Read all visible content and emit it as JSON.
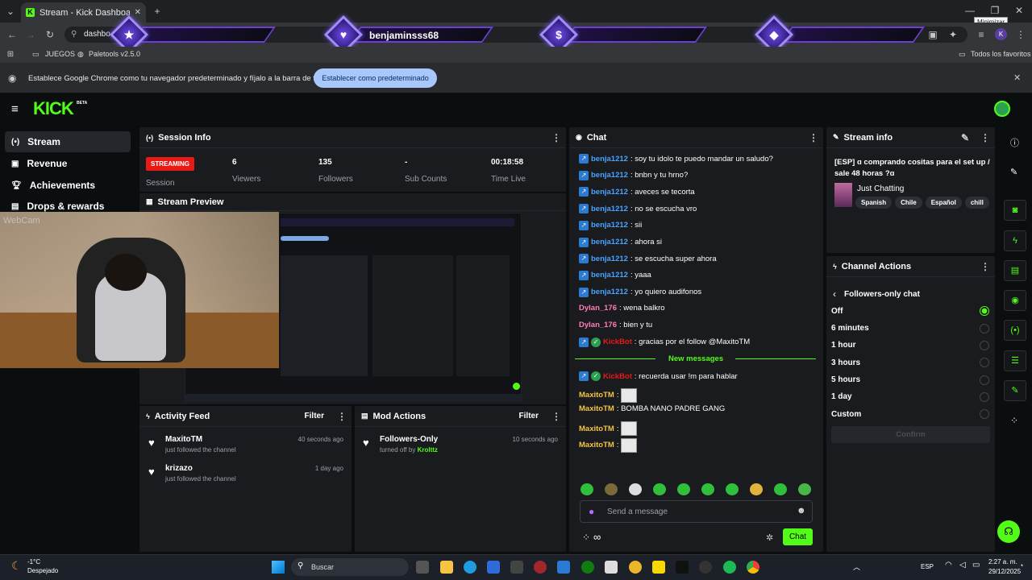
{
  "browser": {
    "tab_title": "Stream - Kick Dashboard",
    "address": "dashbo",
    "tooltip": "Minimizar",
    "bookmarks": [
      "JUEGOS",
      "Paletools v2.5.0"
    ],
    "all_bookmarks": "Todos los favoritos",
    "infobar_text": "Establece Google Chrome como tu navegador predeterminado y fíjalo a la barra de tareas",
    "infobar_button": "Establecer como predeterminado",
    "profile_initial": "K"
  },
  "overlay": {
    "username": "benjaminsss68",
    "icons": [
      "star-icon",
      "heart-icon",
      "dollar-icon",
      "diamond-icon"
    ]
  },
  "kick": {
    "logo": "KICK",
    "logo_badge": "BETA"
  },
  "sidebar": {
    "items": [
      {
        "label": "Stream",
        "icon": "broadcast-icon"
      },
      {
        "label": "Revenue",
        "icon": "revenue-icon"
      },
      {
        "label": "Achievements",
        "icon": "trophy-icon"
      },
      {
        "label": "Drops & rewards",
        "icon": "gift-icon"
      }
    ]
  },
  "session": {
    "title": "Session Info",
    "status": "STREAMING",
    "status_label": "Session",
    "stats": [
      {
        "value": "6",
        "label": "Viewers"
      },
      {
        "value": "135",
        "label": "Followers"
      },
      {
        "value": "-",
        "label": "Sub Counts"
      },
      {
        "value": "00:18:58",
        "label": "Time Live"
      }
    ]
  },
  "preview": {
    "title": "Stream Preview",
    "webcam_label": "WebCam"
  },
  "activity": {
    "title": "Activity Feed",
    "filter": "Filter",
    "items": [
      {
        "name": "MaxitoTM",
        "sub": "just followed the channel",
        "time": "40 seconds ago"
      },
      {
        "name": "krizazo",
        "sub": "just followed the channel",
        "time": "1 day ago"
      }
    ]
  },
  "mod": {
    "title": "Mod Actions",
    "filter": "Filter",
    "items": [
      {
        "name": "Followers-Only",
        "sub_prefix": "turned off by",
        "by": "Krolttz",
        "time": "10 seconds ago"
      }
    ]
  },
  "chat": {
    "title": "Chat",
    "messages": [
      {
        "user": "benja1212",
        "text": ": soy tu idolo te puedo mandar un saludo?"
      },
      {
        "user": "benja1212",
        "text": ": bnbn y tu hrno?"
      },
      {
        "user": "benja1212",
        "text": ": aveces se tecorta"
      },
      {
        "user": "benja1212",
        "text": ": no se escucha vro"
      },
      {
        "user": "benja1212",
        "text": ": sii"
      },
      {
        "user": "benja1212",
        "text": ": ahora si"
      },
      {
        "user": "benja1212",
        "text": ": se escucha super ahora"
      },
      {
        "user": "benja1212",
        "text": ": yaaa"
      },
      {
        "user": "benja1212",
        "text": ": yo quiero audifonos"
      },
      {
        "user": "Dylan_176",
        "text": ": wena balkro"
      },
      {
        "user": "Dylan_176",
        "text": ": bien y tu"
      },
      {
        "user": "KickBot",
        "text": ": gracias por el follow @MaxitoTM"
      }
    ],
    "new_messages": "New messages",
    "after": [
      {
        "user": "KickBot",
        "text": ": recuerda usar !m para hablar"
      },
      {
        "user": "MaxitoTM",
        "text": ":"
      },
      {
        "user": "MaxitoTM",
        "text": ": BOMBA NANO PADRE GANG"
      },
      {
        "user": "MaxitoTM",
        "text": ":"
      },
      {
        "user": "MaxitoTM",
        "text": ":"
      }
    ],
    "placeholder": "Send a message",
    "send": "Chat"
  },
  "stream_info": {
    "title": "Stream info",
    "stream_title": "[ESP] ɑ comprando cositas para el set up / sale 48 horas ?ɑ",
    "category": "Just Chatting",
    "tags": [
      "Spanish",
      "Chile",
      "Español",
      "chill"
    ]
  },
  "channel_actions": {
    "title": "Channel Actions",
    "sub_title": "Followers-only chat",
    "options": [
      "Off",
      "6 minutes",
      "1 hour",
      "3 hours",
      "5 hours",
      "1 day",
      "Custom"
    ],
    "selected": "Off",
    "confirm": "Confirm"
  },
  "taskbar": {
    "weather_temp": "-1°C",
    "weather_desc": "Despejado",
    "search": "Buscar",
    "lang": "ESP",
    "time": "2:27 a. m.",
    "date": "29/12/2025"
  },
  "colors": {
    "accent": "#53fc18",
    "streaming": "#e91916",
    "link": "#4aa3ff"
  }
}
